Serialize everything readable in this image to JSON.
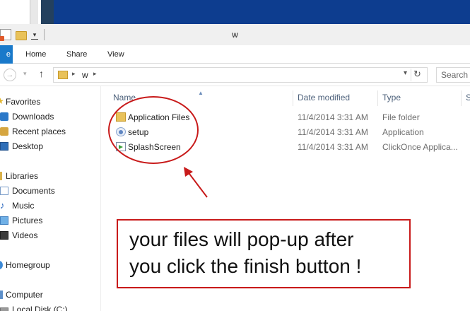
{
  "window": {
    "title": "w"
  },
  "ribbon": {
    "file_tab": "e",
    "tabs": [
      {
        "label": "Home"
      },
      {
        "label": "Share"
      },
      {
        "label": "View"
      }
    ]
  },
  "address_bar": {
    "path_segments": [
      "w"
    ],
    "search_placeholder": "Search w"
  },
  "sidebar": {
    "items": [
      {
        "label": "Favorites",
        "icon": "star-icon",
        "group": true
      },
      {
        "label": "Downloads",
        "icon": "downloads-icon"
      },
      {
        "label": "Recent places",
        "icon": "recent-places-icon"
      },
      {
        "label": "Desktop",
        "icon": "desktop-icon"
      },
      {
        "label": "Libraries",
        "icon": "libraries-icon",
        "group": true
      },
      {
        "label": "Documents",
        "icon": "documents-icon"
      },
      {
        "label": "Music",
        "icon": "music-icon"
      },
      {
        "label": "Pictures",
        "icon": "pictures-icon"
      },
      {
        "label": "Videos",
        "icon": "videos-icon"
      },
      {
        "label": "Homegroup",
        "icon": "homegroup-icon",
        "group": true
      },
      {
        "label": "Computer",
        "icon": "computer-icon",
        "group": true
      },
      {
        "label": "Local Disk (C:)",
        "icon": "local-disk-icon"
      }
    ]
  },
  "file_list": {
    "columns": {
      "name": "Name",
      "date_modified": "Date modified",
      "type": "Type",
      "size": "S"
    },
    "rows": [
      {
        "name": "Application Files",
        "date": "11/4/2014 3:31 AM",
        "type": "File folder",
        "icon": "folder-icon"
      },
      {
        "name": "setup",
        "date": "11/4/2014 3:31 AM",
        "type": "Application",
        "icon": "setup-icon"
      },
      {
        "name": "SplashScreen",
        "date": "11/4/2014 3:31 AM",
        "type": "ClickOnce Applica...",
        "icon": "clickonce-icon"
      }
    ]
  },
  "annotation": {
    "line1": "your files will pop-up after",
    "line2": "you click the finish button !",
    "color": "#c81a1a"
  },
  "icons": {
    "back": "←",
    "forward": "→",
    "up": "↑",
    "refresh": "↻",
    "chevron": "▸",
    "dropdown": "▾",
    "sort_up": "▲",
    "star": "★",
    "note": "♪"
  }
}
